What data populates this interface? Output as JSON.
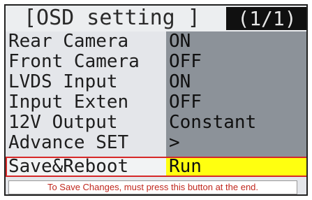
{
  "header": {
    "title": "[OSD setting ]",
    "page_indicator": "(1/1)"
  },
  "rows": [
    {
      "label": "Rear Camera",
      "value": "ON"
    },
    {
      "label": "Front Camera",
      "value": "OFF"
    },
    {
      "label": "LVDS Input",
      "value": "ON"
    },
    {
      "label": "Input Exten",
      "value": "OFF"
    },
    {
      "label": "12V Output",
      "value": "Constant"
    },
    {
      "label": "Advance SET",
      "value": ">"
    },
    {
      "label": "Save&Reboot",
      "value": "Run"
    }
  ],
  "note": "To Save Changes, must press this button at the end.",
  "colors": {
    "selected_value_bg": "#ffff10",
    "highlight_border": "#d62828",
    "note_text": "#c0281e",
    "page_indicator_bg": "#101010"
  }
}
